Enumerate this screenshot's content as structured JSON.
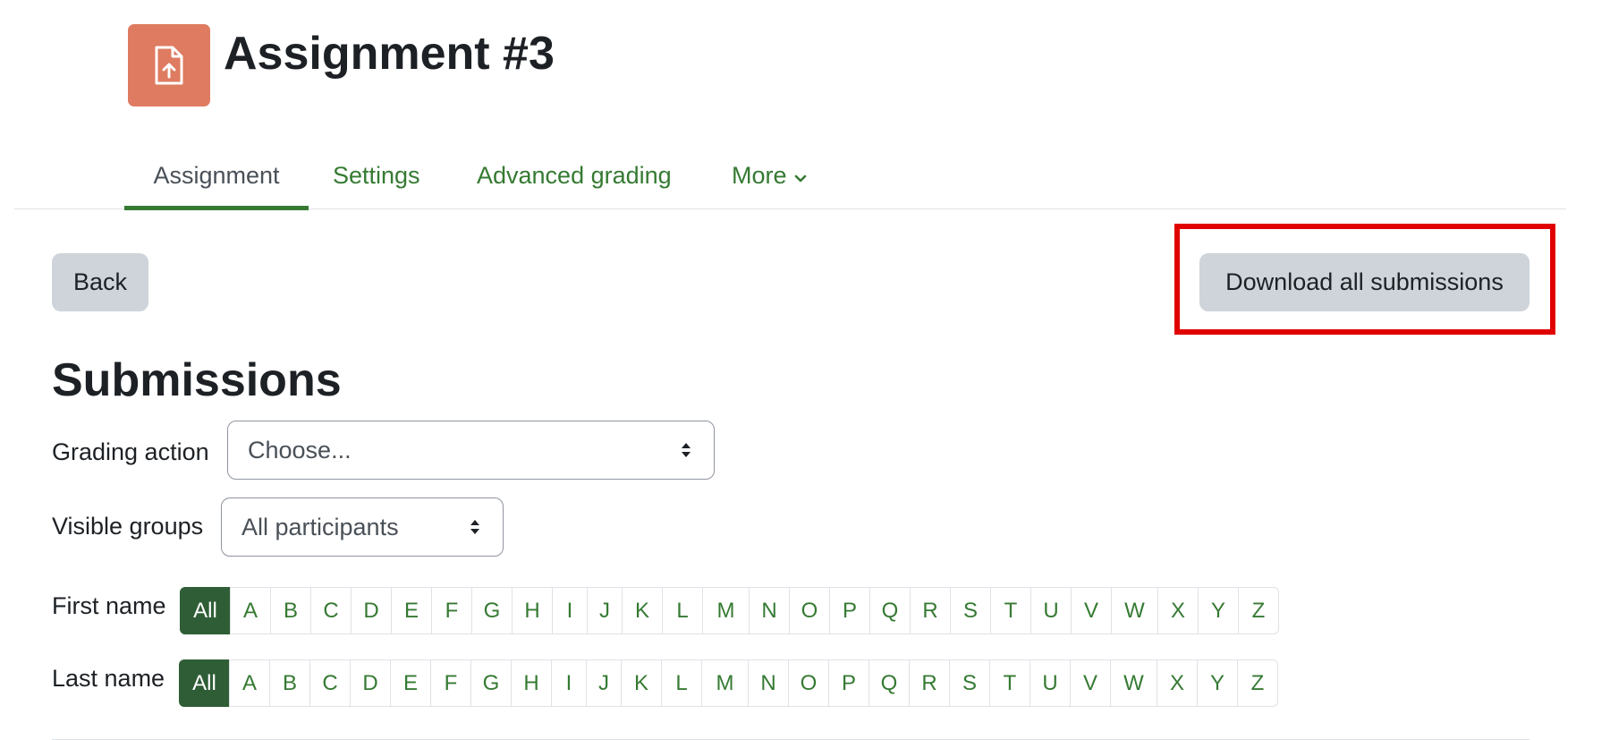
{
  "header": {
    "title": "Assignment #3",
    "icon": "file-upload-icon",
    "icon_color": "#de7b60"
  },
  "tabs": [
    {
      "label": "Assignment",
      "active": true
    },
    {
      "label": "Settings",
      "active": false
    },
    {
      "label": "Advanced grading",
      "active": false
    },
    {
      "label": "More",
      "active": false
    }
  ],
  "actions": {
    "back_label": "Back",
    "download_label": "Download all submissions",
    "highlight_color": "#e00000"
  },
  "section": {
    "title": "Submissions"
  },
  "grading_action": {
    "label": "Grading action",
    "value": "Choose..."
  },
  "visible_groups": {
    "label": "Visible groups",
    "value": "All participants"
  },
  "first_name": {
    "label": "First name",
    "initials": [
      "All",
      "A",
      "B",
      "C",
      "D",
      "E",
      "F",
      "G",
      "H",
      "I",
      "J",
      "K",
      "L",
      "M",
      "N",
      "O",
      "P",
      "Q",
      "R",
      "S",
      "T",
      "U",
      "V",
      "W",
      "X",
      "Y",
      "Z"
    ],
    "selected": "All"
  },
  "last_name": {
    "label": "Last name",
    "initials": [
      "All",
      "A",
      "B",
      "C",
      "D",
      "E",
      "F",
      "G",
      "H",
      "I",
      "J",
      "K",
      "L",
      "M",
      "N",
      "O",
      "P",
      "Q",
      "R",
      "S",
      "T",
      "U",
      "V",
      "W",
      "X",
      "Y",
      "Z"
    ],
    "selected": "All"
  },
  "colors": {
    "link": "#357a32",
    "active_initial": "#2f5e36",
    "button": "#ced4da"
  }
}
